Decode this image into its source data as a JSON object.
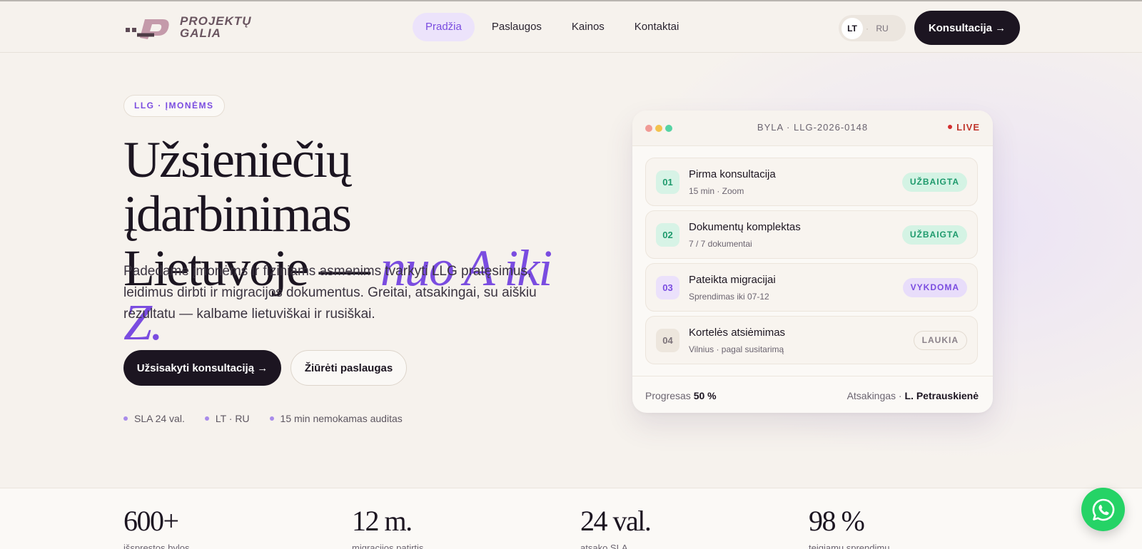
{
  "header": {
    "logo_text": "PROJEKTŲ GALIA",
    "nav": [
      {
        "label": "Pradžia",
        "active": true
      },
      {
        "label": "Paslaugos",
        "active": false
      },
      {
        "label": "Kainos",
        "active": false
      },
      {
        "label": "Kontaktai",
        "active": false
      }
    ],
    "lang": {
      "lt": "LT",
      "sep": "·",
      "ru": "RU",
      "selected": "LT"
    },
    "cta": "Konsultacija →"
  },
  "hero": {
    "pill": "LLG · ĮMONĖMS",
    "title_line1": "Užsieniečių įdarbinimas",
    "title_line2_plain": "Lietuvoje — ",
    "title_line2_accent": "nuo A iki Z.",
    "lead": "Padedame įmonėms ir fiziniams asmenims tvarkyti LLG pratęsimus, leidimus dirbti ir migracijos dokumentus. Greitai, atsakingai, su aiškiu rezultatu — kalbame lietuviškai ir rusiškai.",
    "primary_button": "Užsisakyti konsultaciją  →",
    "secondary_button": "Žiūrėti paslaugas",
    "facts": [
      "SLA 24 val.",
      "LT · RU",
      "15 min nemokamas auditas"
    ]
  },
  "card": {
    "case_id": "BYLA · LLG-2026-0148",
    "live": "LIVE",
    "steps": [
      {
        "num": "01",
        "title": "Pirma konsultacija",
        "sub": "15 min · Zoom",
        "status": "UŽBAIGTA"
      },
      {
        "num": "02",
        "title": "Dokumentų komplektas",
        "sub": "7 / 7 dokumentai",
        "status": "UŽBAIGTA"
      },
      {
        "num": "03",
        "title": "Pateikta migracijai",
        "sub": "Sprendimas iki 07-12",
        "status": "VYKDOMA"
      },
      {
        "num": "04",
        "title": "Kortelės atsiėmimas",
        "sub": "Vilnius · pagal susitarimą",
        "status": "LAUKIA"
      }
    ],
    "progress_label": "Progresas",
    "progress_value": "50 %",
    "owner_label": "Atsakingas ·",
    "owner_name": "L. Petrauskienė"
  },
  "stats": [
    {
      "value": "600+",
      "label": "išspręstos bylos"
    },
    {
      "value": "12 m.",
      "label": "migracijos patirtis"
    },
    {
      "value": "24 val.",
      "label": "atsako SLA"
    },
    {
      "value": "98 %",
      "label": "teigiamų sprendimų"
    }
  ],
  "colors": {
    "accent": "#7a4ce0",
    "dark": "#1c1521",
    "background": "#f6f2ed",
    "done": "#1e9a6c",
    "live": "#c0362c",
    "whatsapp": "#25d366"
  },
  "icons": {
    "whatsapp": "whatsapp-icon",
    "logo": "logo-mark-icon"
  }
}
